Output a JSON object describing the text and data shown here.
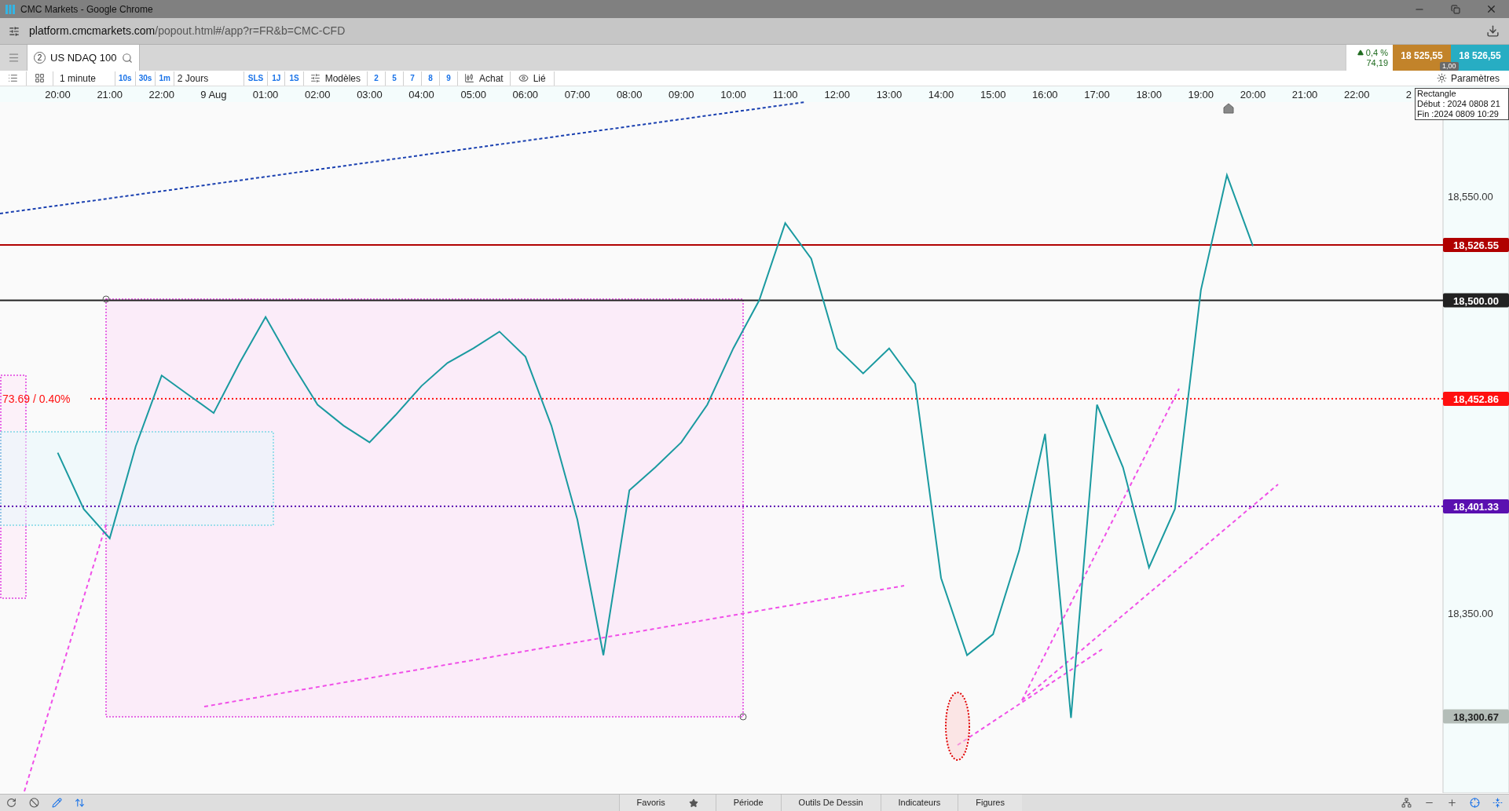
{
  "window": {
    "title": "CMC Markets - Google Chrome"
  },
  "address_bar": {
    "domain": "platform.cmcmarkets.com",
    "path": "/popout.html#/app?r=FR&b=CMC-CFD"
  },
  "instrument_tab": {
    "number": "2",
    "name": "US NDAQ 100"
  },
  "quote": {
    "change_pct": "0,4 %",
    "change": "74,19",
    "sell": "18 525,55",
    "buy": "18 526,55",
    "size": "1,00"
  },
  "toolbar": {
    "interval": "1 minute",
    "interval_buttons": [
      "10s",
      "30s",
      "1m"
    ],
    "range": "2 Jours",
    "range_buttons": [
      "SLS",
      "1J",
      "1S"
    ],
    "templates": "Modèles",
    "count_buttons": [
      "2",
      "5",
      "7",
      "8",
      "9"
    ],
    "action": "Achat",
    "linked": "Lié",
    "settings": "Paramètres"
  },
  "chart": {
    "time_labels": [
      "20:00",
      "21:00",
      "22:00",
      "9 Aug",
      "01:00",
      "02:00",
      "03:00",
      "04:00",
      "05:00",
      "06:00",
      "07:00",
      "08:00",
      "09:00",
      "10:00",
      "11:00",
      "12:00",
      "13:00",
      "14:00",
      "15:00",
      "16:00",
      "17:00",
      "18:00",
      "19:00",
      "20:00",
      "21:00",
      "22:00",
      "2"
    ],
    "price_ticks": [
      "18,550.00",
      "18,350.00"
    ],
    "price_tags": [
      {
        "label": "18,526.55",
        "color": "#b00000",
        "dotted": false,
        "line_shown": true
      },
      {
        "label": "18,500.00",
        "color": "#222222",
        "dotted": false,
        "line_shown": true
      },
      {
        "label": "18,452.86",
        "color": "#ff1010",
        "dotted": true,
        "line_shown": true,
        "note": "73.69 / 0.40%"
      },
      {
        "label": "18,401.33",
        "color": "#5a10b0",
        "dotted": true,
        "line_shown": true
      },
      {
        "label": "18,300.67",
        "color": "#b4bdb8",
        "line_shown": false
      }
    ],
    "tooltip": {
      "title": "Rectangle",
      "lines": [
        "Début : 2024 0808 21",
        "Fin :2024 0809 10:29"
      ]
    }
  },
  "bottom_tabs": [
    {
      "label": "Favoris",
      "kind": "star"
    },
    {
      "label": "Période",
      "kind": "plain"
    },
    {
      "label": "Outils De Dessin",
      "kind": "plain"
    },
    {
      "label": "Indicateurs",
      "kind": "plain"
    },
    {
      "label": "Figures",
      "kind": "plain"
    }
  ]
}
